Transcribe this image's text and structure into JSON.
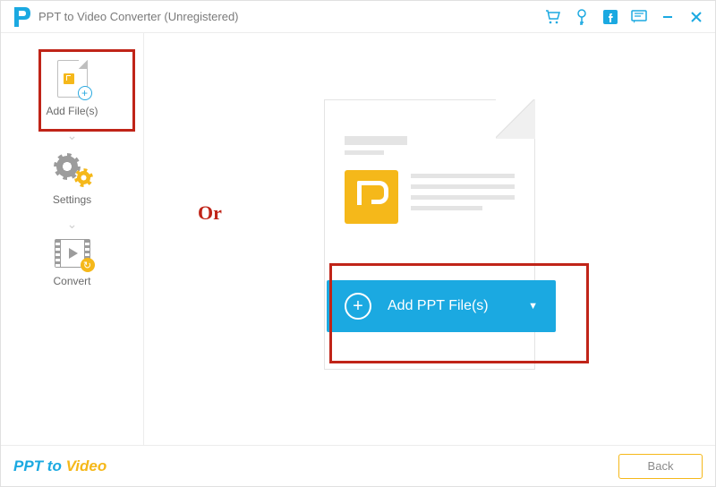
{
  "window_title": "PPT to Video Converter (Unregistered)",
  "title_icons": {
    "cart": "cart-icon",
    "key": "key-icon",
    "facebook": "facebook-icon",
    "feedback": "feedback-icon",
    "minimize": "minimize-icon",
    "close": "close-icon"
  },
  "sidebar": {
    "steps": [
      {
        "label": "Add File(s)"
      },
      {
        "label": "Settings"
      },
      {
        "label": "Convert"
      }
    ]
  },
  "annotation": {
    "or": "Or"
  },
  "main_button": {
    "label": "Add PPT File(s)"
  },
  "footer": {
    "brand_a": "PPT to ",
    "brand_b": "Video",
    "back": "Back"
  },
  "colors": {
    "accent_blue": "#1ba9e1",
    "accent_yellow": "#f5b81a",
    "highlight_red": "#c02418"
  }
}
